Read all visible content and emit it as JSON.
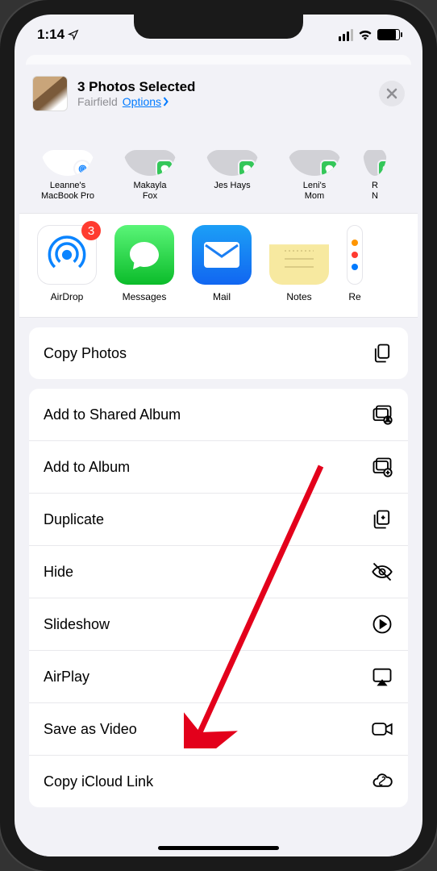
{
  "status": {
    "time": "1:14"
  },
  "header": {
    "title": "3 Photos Selected",
    "location": "Fairfield",
    "options_label": "Options"
  },
  "contacts": [
    {
      "name_line1": "Leanne's",
      "name_line2": "MacBook Pro",
      "badge": "airdrop"
    },
    {
      "name_line1": "Makayla",
      "name_line2": "Fox",
      "badge": "messages"
    },
    {
      "name_line1": "Jes Hays",
      "name_line2": "",
      "badge": "messages"
    },
    {
      "name_line1": "Leni's",
      "name_line2": "Mom",
      "badge": "messages"
    },
    {
      "name_line1": "R",
      "name_line2": "N",
      "badge": "messages"
    }
  ],
  "apps": [
    {
      "label": "AirDrop",
      "icon": "airdrop",
      "badge": "3"
    },
    {
      "label": "Messages",
      "icon": "messages",
      "badge": ""
    },
    {
      "label": "Mail",
      "icon": "mail",
      "badge": ""
    },
    {
      "label": "Notes",
      "icon": "notes",
      "badge": ""
    },
    {
      "label": "Re",
      "icon": "reminders",
      "badge": ""
    }
  ],
  "actions": {
    "group1": [
      {
        "label": "Copy Photos",
        "icon": "copy"
      }
    ],
    "group2": [
      {
        "label": "Add to Shared Album",
        "icon": "shared-album"
      },
      {
        "label": "Add to Album",
        "icon": "add-album"
      },
      {
        "label": "Duplicate",
        "icon": "duplicate"
      },
      {
        "label": "Hide",
        "icon": "hide"
      },
      {
        "label": "Slideshow",
        "icon": "slideshow"
      },
      {
        "label": "AirPlay",
        "icon": "airplay"
      },
      {
        "label": "Save as Video",
        "icon": "video"
      },
      {
        "label": "Copy iCloud Link",
        "icon": "icloud-link"
      }
    ]
  }
}
